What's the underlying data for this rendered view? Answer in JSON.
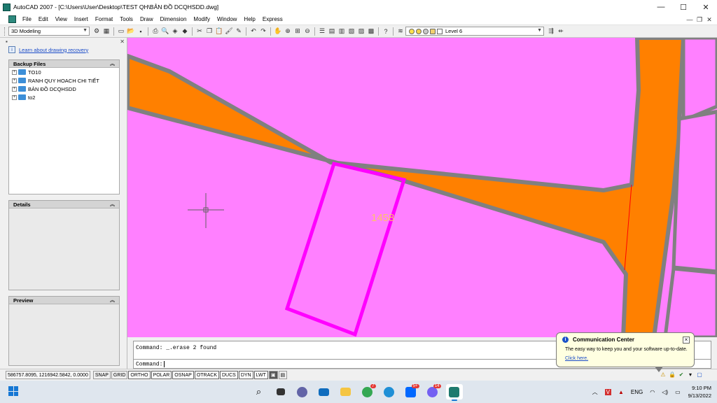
{
  "window": {
    "title": "AutoCAD 2007 - [C:\\Users\\User\\Desktop\\TEST QH\\BẢN ĐỒ DCQHSDD.dwg]",
    "controls": [
      "—",
      "☐",
      "✕"
    ]
  },
  "menubar": {
    "items": [
      "File",
      "Edit",
      "View",
      "Insert",
      "Format",
      "Tools",
      "Draw",
      "Dimension",
      "Modify",
      "Window",
      "Help",
      "Express"
    ],
    "doc_controls": [
      "—",
      "❐",
      "✕"
    ]
  },
  "toolbar": {
    "workspace": "3D Modeling",
    "layer": "Level 6"
  },
  "palette": {
    "close": "✕",
    "learn_link": "Learn about drawing recovery",
    "backup_files": {
      "title": "Backup Files",
      "items": [
        "TO10",
        "RANH QUY HOACH CHI TIẾT",
        "BẢN ĐỒ DCQHSDD",
        "to2"
      ]
    },
    "details_title": "Details",
    "preview_title": "Preview"
  },
  "drawing": {
    "parcel_label": "1458",
    "colors": {
      "background": "#ff80ff",
      "road": "#ff8000",
      "border": "#808080",
      "parcel": "#ff00ff",
      "label": "#ffc06a",
      "crosshair": "#606060"
    }
  },
  "command": {
    "line1": "Command: _.erase 2 found",
    "prompt": "Command:"
  },
  "status": {
    "coords": "586757.8095, 1216942.5842, 0.0000",
    "toggles": [
      "SNAP",
      "GRID",
      "ORTHO",
      "POLAR",
      "OSNAP",
      "OTRACK",
      "DUCS",
      "DYN",
      "LWT"
    ]
  },
  "balloon": {
    "title": "Communication Center",
    "message": "The easy way to keep you and your software up-to-date.",
    "link": "Click here."
  },
  "taskbar": {
    "badges": {
      "chrome": "7",
      "zalo": "5+",
      "viber": "14"
    },
    "language": "ENG",
    "time": "9:10 PM",
    "date": "9/13/2022"
  }
}
